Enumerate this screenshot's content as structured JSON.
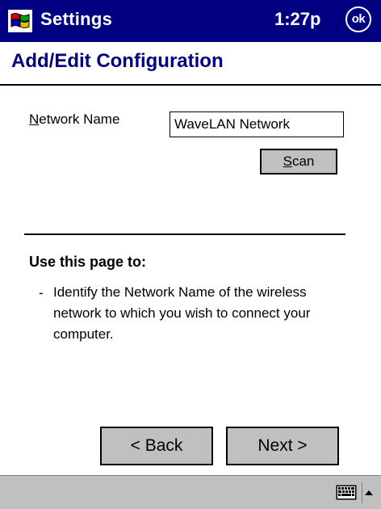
{
  "titlebar": {
    "app_title": "Settings",
    "time": "1:27p",
    "ok_label": "ok"
  },
  "page": {
    "heading": "Add/Edit Configuration"
  },
  "form": {
    "network_name_label_accel": "N",
    "network_name_label_rest": "etwork Name",
    "network_name_value": "WaveLAN Network",
    "scan_label_accel": "S",
    "scan_label_rest": "can"
  },
  "help": {
    "heading": "Use this page to:",
    "bullet": "-",
    "text": "Identify the Network Name of the wireless network to which you wish to connect your computer."
  },
  "wizard": {
    "back_label": "< Back",
    "next_label": "Next >"
  },
  "colors": {
    "titlebar_bg": "#000080",
    "heading_text": "#000080",
    "button_face": "#c0c0c0"
  },
  "icons": {
    "start": "windows-flag-icon",
    "keyboard": "keyboard-icon",
    "sip_toggle": "arrow-up-icon"
  }
}
